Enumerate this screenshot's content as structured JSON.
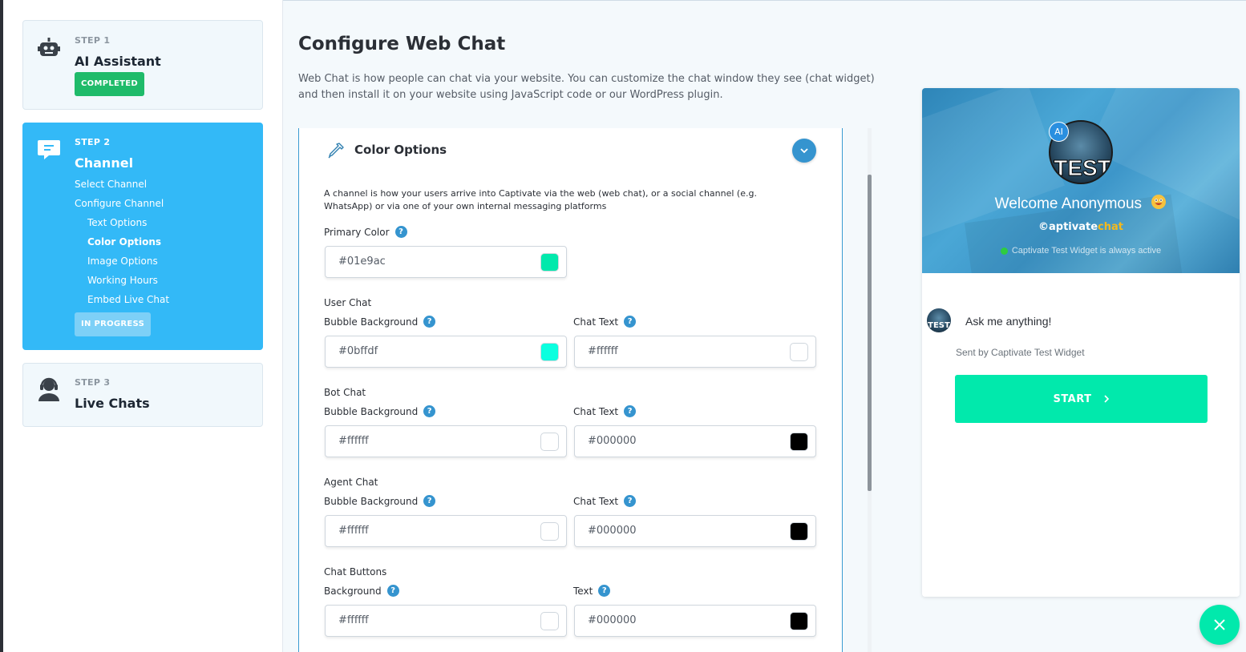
{
  "sidebar": {
    "steps": [
      {
        "label": "STEP 1",
        "title": "AI Assistant",
        "badge": "COMPLETED",
        "icon": "robot-icon"
      },
      {
        "label": "STEP 2",
        "title": "Channel",
        "badge": "IN PROGRESS",
        "icon": "chat-icon",
        "items": [
          "Select Channel",
          "Configure Channel",
          "Text Options",
          "Color Options",
          "Image Options",
          "Working Hours",
          "Embed Live Chat"
        ],
        "current_item": "Color Options"
      },
      {
        "label": "STEP 3",
        "title": "Live Chats",
        "icon": "headset-agent-icon"
      }
    ]
  },
  "main": {
    "title": "Configure Web Chat",
    "description": "Web Chat is how people can chat via your website. You can customize the chat window they see (chat widget) and then install it on your website using JavaScript code or our WordPress plugin."
  },
  "panel": {
    "title": "Color Options",
    "icon": "eyedropper-icon",
    "description": "A channel is how your users arrive into Captivate via the web (web chat), or a social channel (e.g. WhatsApp) or via one of your own internal messaging platforms",
    "help_glyph": "?",
    "primary": {
      "label": "Primary Color",
      "value": "#01e9ac",
      "swatch": "#01e9ac"
    },
    "user_chat": {
      "group": "User Chat",
      "bg_label": "Bubble Background",
      "bg_value": "#0bffdf",
      "bg_swatch": "#0bffdf",
      "text_label": "Chat Text",
      "text_value": "#ffffff",
      "text_swatch": "#ffffff"
    },
    "bot_chat": {
      "group": "Bot Chat",
      "bg_label": "Bubble Background",
      "bg_value": "#ffffff",
      "bg_swatch": "#ffffff",
      "text_label": "Chat Text",
      "text_value": "#000000",
      "text_swatch": "#000000"
    },
    "agent_chat": {
      "group": "Agent Chat",
      "bg_label": "Bubble Background",
      "bg_value": "#ffffff",
      "bg_swatch": "#ffffff",
      "text_label": "Chat Text",
      "text_value": "#000000",
      "text_swatch": "#000000"
    },
    "chat_buttons": {
      "group": "Chat Buttons",
      "bg_label": "Background",
      "bg_value": "#ffffff",
      "bg_swatch": "#ffffff",
      "text_label": "Text",
      "text_value": "#000000",
      "text_swatch": "#000000"
    }
  },
  "widget": {
    "ai_badge": "AI",
    "avatar_text": "TEST",
    "welcome": "Welcome Anonymous",
    "welcome_emoji": "grinning-face-emoji",
    "brand_prefix": "©aptivate",
    "brand_accent": "chat",
    "status": "Captivate Test Widget is always active",
    "message": "Ask me anything!",
    "sent_by": "Sent by Captivate Test Widget",
    "start_label": "START",
    "start_color": "#01e9ac",
    "close_icon": "close-icon"
  }
}
